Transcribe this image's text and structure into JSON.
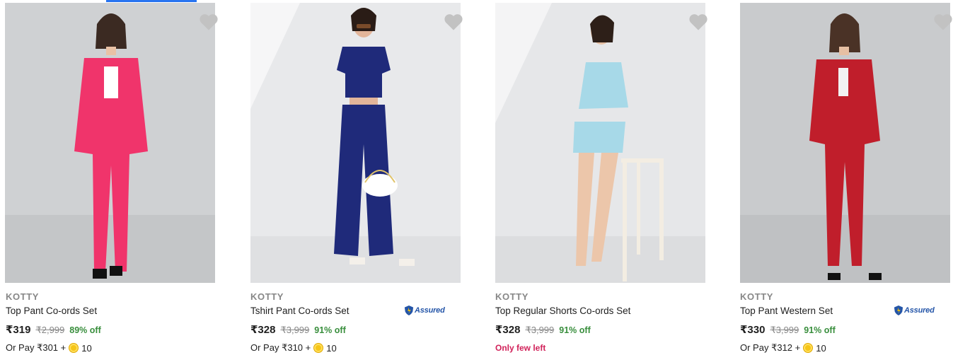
{
  "products": [
    {
      "brand": "KOTTY",
      "title": "Top Pant Co-ords Set",
      "price": "₹319",
      "mrp": "₹2,999",
      "discount": "89% off",
      "pay": "Or Pay ₹301 +",
      "coins": "10",
      "assured": false,
      "stock_note": "",
      "outfit_color": "#f0346b",
      "bg_color": "#cfd1d3"
    },
    {
      "brand": "KOTTY",
      "title": "Tshirt Pant Co-ords Set",
      "price": "₹328",
      "mrp": "₹3,999",
      "discount": "91% off",
      "pay": "Or Pay ₹310 +",
      "coins": "10",
      "assured": true,
      "assured_label": "Assured",
      "stock_note": "",
      "outfit_color": "#1f2a7a",
      "bg_color": "#e8e9eb"
    },
    {
      "brand": "KOTTY",
      "title": "Top Regular Shorts Co-ords Set",
      "price": "₹328",
      "mrp": "₹3,999",
      "discount": "91% off",
      "pay": "",
      "coins": "",
      "assured": false,
      "stock_note": "Only few left",
      "outfit_color": "#a7d9e8",
      "bg_color": "#e6e7e9"
    },
    {
      "brand": "KOTTY",
      "title": "Top Pant Western Set",
      "price": "₹330",
      "mrp": "₹3,999",
      "discount": "91% off",
      "pay": "Or Pay ₹312 +",
      "coins": "10",
      "assured": true,
      "assured_label": "Assured",
      "stock_note": "",
      "outfit_color": "#c01e2b",
      "bg_color": "#c9cbcd"
    }
  ],
  "icons": {
    "wishlist": "heart-icon",
    "coin": "supercoin-icon",
    "assured": "assured-badge-icon"
  },
  "colors": {
    "accent": "#2874f0",
    "discount": "#388e3c",
    "few_left": "#d1225a",
    "muted": "#878787"
  }
}
